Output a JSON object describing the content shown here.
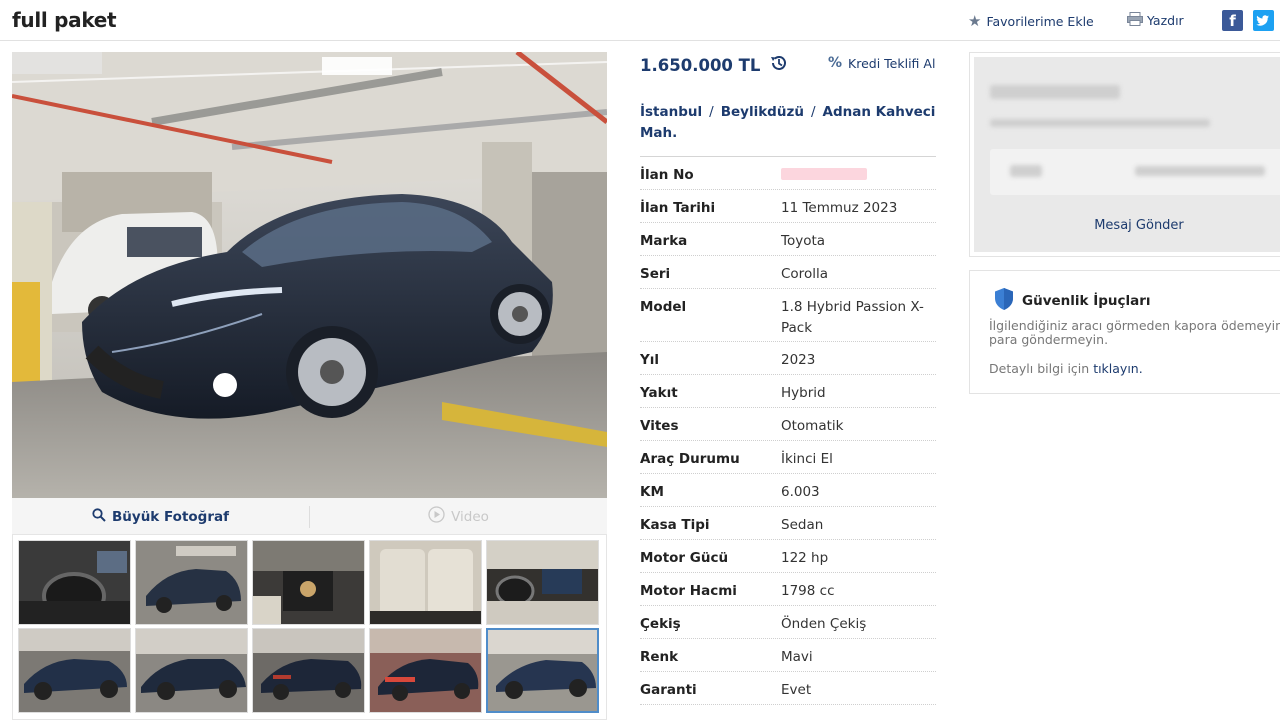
{
  "header": {
    "title": "full paket",
    "favorite_label": "Favorilerime Ekle",
    "print_label": "Yazdır",
    "facebook_glyph": "f"
  },
  "gallery": {
    "big_photo_label": "Büyük Fotoğraf",
    "video_label": "Video",
    "thumbnail_count": 10,
    "selected_thumbnail": 10
  },
  "listing": {
    "price": "1.650.000 TL",
    "credit_label": "Kredi Teklifi Al",
    "location": {
      "city": "İstanbul",
      "district": "Beylikdüzü",
      "neighborhood": "Adnan Kahveci Mah.",
      "separator": "/"
    }
  },
  "specs": [
    {
      "key": "İlan No",
      "value": ""
    },
    {
      "key": "İlan Tarihi",
      "value": "11 Temmuz 2023"
    },
    {
      "key": "Marka",
      "value": "Toyota"
    },
    {
      "key": "Seri",
      "value": "Corolla"
    },
    {
      "key": "Model",
      "value": "1.8 Hybrid Passion X-Pack"
    },
    {
      "key": "Yıl",
      "value": "2023"
    },
    {
      "key": "Yakıt",
      "value": "Hybrid"
    },
    {
      "key": "Vites",
      "value": "Otomatik"
    },
    {
      "key": "Araç Durumu",
      "value": "İkinci El"
    },
    {
      "key": "KM",
      "value": "6.003"
    },
    {
      "key": "Kasa Tipi",
      "value": "Sedan"
    },
    {
      "key": "Motor Gücü",
      "value": "122 hp"
    },
    {
      "key": "Motor Hacmi",
      "value": "1798 cc"
    },
    {
      "key": "Çekiş",
      "value": "Önden Çekiş"
    },
    {
      "key": "Renk",
      "value": "Mavi"
    },
    {
      "key": "Garanti",
      "value": "Evet"
    }
  ],
  "seller": {
    "message_label": "Mesaj Gönder"
  },
  "safety": {
    "title": "Güvenlik İpuçları",
    "text": "İlgilendiğiniz aracı görmeden kapora ödemeyin, para göndermeyin.",
    "more_prefix": "Detaylı bilgi için",
    "more_link": "tıklayın."
  },
  "colors": {
    "brand_navy": "#1d3b6e",
    "facebook": "#3b5998",
    "twitter": "#1da1f2",
    "shield": "#3b7fd4"
  }
}
